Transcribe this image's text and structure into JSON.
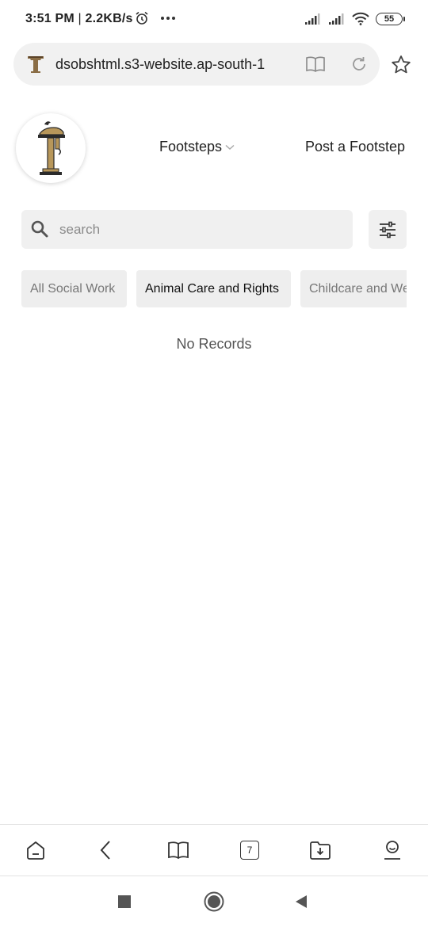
{
  "status_bar": {
    "time": "3:51 PM",
    "network_speed": "2.2KB/s",
    "battery_level": "55",
    "icons": [
      "alarm-icon",
      "more-dots-icon",
      "signal-icon",
      "signal-icon",
      "wifi-icon",
      "battery-icon"
    ]
  },
  "browser": {
    "url": "dsobshtml.s3-website.ap-south-1",
    "tabs_count": "7",
    "icons": [
      "site-favicon",
      "reader-mode-icon",
      "reload-icon",
      "star-icon"
    ]
  },
  "site": {
    "nav": {
      "footsteps_label": "Footsteps",
      "post_label": "Post a Footstep"
    },
    "search": {
      "placeholder": "search"
    },
    "chips": [
      {
        "label": "All Social Work",
        "active": false
      },
      {
        "label": "Animal Care and Rights",
        "active": true
      },
      {
        "label": "Childcare and Welfare",
        "active": false
      }
    ],
    "empty_message": "No Records"
  },
  "bottom_toolbar": {
    "icons": [
      "home-icon",
      "back-icon",
      "bookmarks-icon",
      "tabs-icon",
      "downloads-icon",
      "profile-icon"
    ]
  },
  "android_nav": {
    "icons": [
      "recents-icon",
      "home-circle-icon",
      "back-triangle-icon"
    ]
  },
  "colors": {
    "accent_gold": "#b8975a",
    "chip_bg": "#eeeeee",
    "search_bg": "#f0f0f0"
  }
}
